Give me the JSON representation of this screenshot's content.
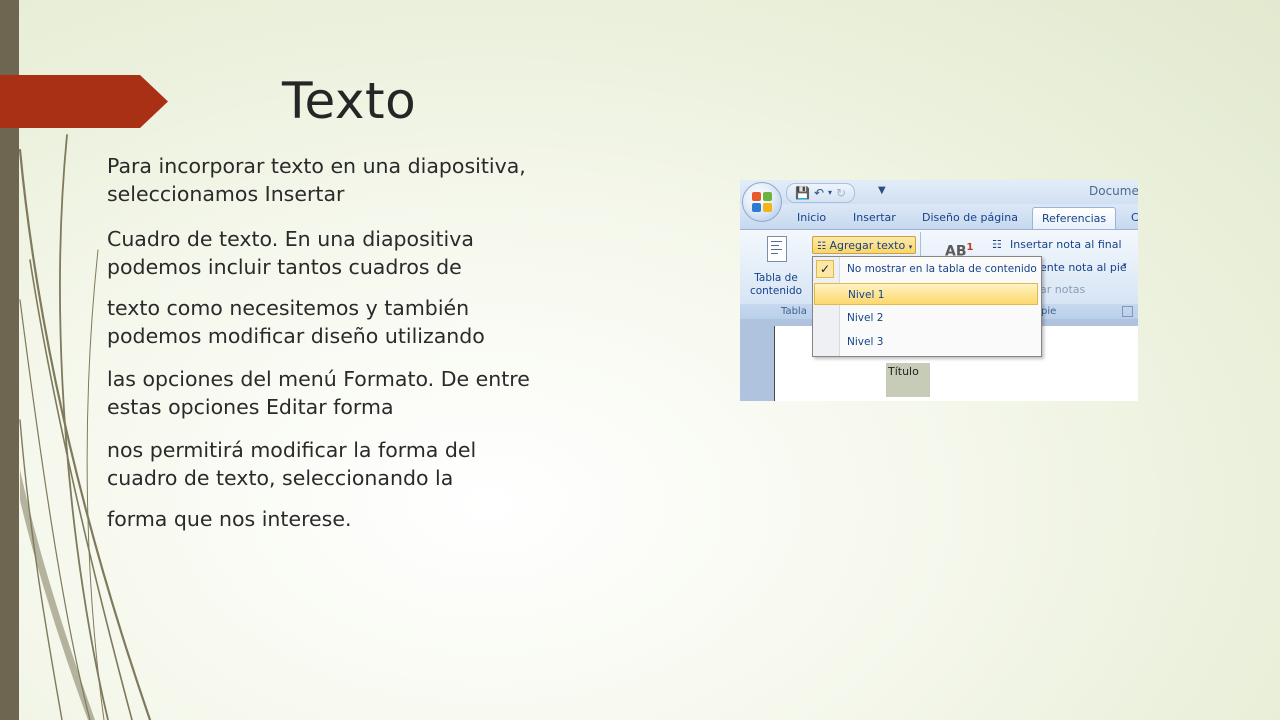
{
  "slide": {
    "title": "Texto",
    "paragraphs": [
      "Para incorporar texto en una diapositiva,\nseleccionamos Insertar",
      "Cuadro de texto. En una diapositiva\npodemos incluir tantos cuadros de",
      "texto como necesitemos y también\npodemos modificar diseño utilizando",
      "las opciones del menú Formato. De entre\nestas opciones Editar forma",
      "nos permitirá modificar la forma del\ncuadro de texto, seleccionando la",
      "forma que nos interese."
    ],
    "colors": {
      "accent_arrow": "#a93014",
      "left_bar": "#6e6650"
    }
  },
  "screenshot": {
    "doc_title": "Docume",
    "qat_icons": [
      "save-icon",
      "undo-icon",
      "redo-icon",
      "customize-qat-icon"
    ],
    "tabs": [
      "Inicio",
      "Insertar",
      "Diseño de página",
      "Referencias",
      "C"
    ],
    "active_tab": "Referencias",
    "ribbon": {
      "toc_button": "Tabla de\ncontenido",
      "add_text_button": "Agregar texto",
      "insert_endnote": "Insertar nota al final",
      "next_footnote": "ente nota al pie",
      "show_notes": "ar notas",
      "group_toc": "Tabla",
      "group_footnotes": "pie"
    },
    "dropdown": {
      "items": [
        "No mostrar en la tabla de contenido",
        "Nivel 1",
        "Nivel 2",
        "Nivel 3"
      ],
      "checked": "No mostrar en la tabla de contenido",
      "highlighted": "Nivel 1"
    },
    "document_text": "Título"
  }
}
